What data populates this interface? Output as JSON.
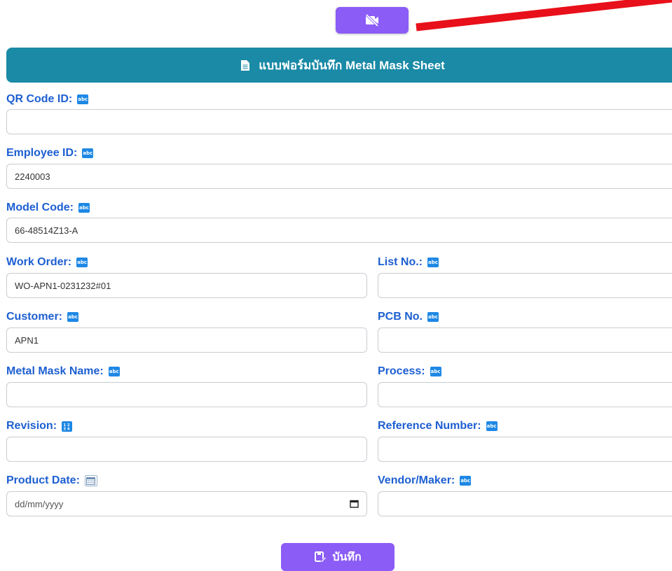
{
  "camera_button": {
    "icon": "camera-off-icon"
  },
  "header": {
    "icon": "document-icon",
    "title": "แบบฟอร์มบันทึก Metal Mask Sheet"
  },
  "fields": {
    "qr_code_id": {
      "label": "QR Code ID:",
      "badge": "abc",
      "value": ""
    },
    "employee_id": {
      "label": "Employee ID:",
      "badge": "abc",
      "value": "2240003"
    },
    "model_code": {
      "label": "Model Code:",
      "badge": "abc",
      "value": "66-48514Z13-A"
    },
    "work_order": {
      "label": "Work Order:",
      "badge": "abc",
      "value": "WO-APN1-0231232#01"
    },
    "list_no": {
      "label": "List No.:",
      "badge": "abc",
      "value": ""
    },
    "customer": {
      "label": "Customer:",
      "badge": "abc",
      "value": "APN1"
    },
    "pcb_no": {
      "label": "PCB No.",
      "badge": "abc",
      "value": ""
    },
    "metal_mask_name": {
      "label": "Metal Mask Name:",
      "badge": "abc",
      "value": ""
    },
    "process": {
      "label": "Process:",
      "badge": "abc",
      "value": ""
    },
    "revision": {
      "label": "Revision:",
      "badge": "12 34",
      "value": ""
    },
    "reference_number": {
      "label": "Reference Number:",
      "badge": "abc",
      "value": ""
    },
    "product_date": {
      "label": "Product Date:",
      "placeholder": "dd/mm/yyyy",
      "value": ""
    },
    "vendor_maker": {
      "label": "Vendor/Maker:",
      "badge": "abc",
      "value": ""
    }
  },
  "save_button": {
    "label": "บันทึก",
    "icon": "save-edit-icon"
  },
  "colors": {
    "header": "#1a8aa6",
    "accent": "#8b5cf6",
    "label": "#1d5fd1",
    "arrow": "#e8101a"
  }
}
